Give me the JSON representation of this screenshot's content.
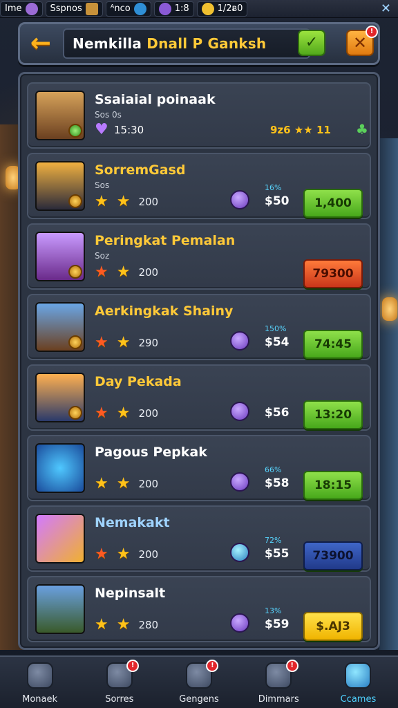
{
  "statusbar": {
    "items": [
      {
        "label": "Ime"
      },
      {
        "label": "Sspnos"
      },
      {
        "label": "ᴬnco"
      },
      {
        "label": "1:8"
      },
      {
        "label": "1/2ᴃ0"
      }
    ],
    "close": "✕"
  },
  "header": {
    "back_icon": "←",
    "title_part1": "Nemkilla ",
    "title_part2": "Dnall P Ganksh",
    "ok_icon": "✓",
    "close_icon": "✕",
    "close_badge": "!"
  },
  "rows": [
    {
      "title": "Ssaiaial poinaak",
      "title_color": "#ffffff",
      "sub": "Sos 0s",
      "time": "15:30",
      "score": "9ᴢ6 ★★ 11",
      "avatar_colors": [
        "#d6a25a",
        "#6b4020"
      ]
    },
    {
      "title": "SorremGasd",
      "title_color": "#ffc938",
      "sub": "Sos",
      "stars": "200",
      "pct": "16%",
      "price": "$50",
      "action": "1,400",
      "action_style": "green",
      "avatar_colors": [
        "#f0b040",
        "#2a2a3a"
      ]
    },
    {
      "title": "Peringkat Pemalan",
      "title_color": "#ffc938",
      "sub": "Soz",
      "stars": "200",
      "action": "79300",
      "action_style": "red",
      "avatar_colors": [
        "#c99bff",
        "#6a2a8a"
      ]
    },
    {
      "title": "Aerkingkak Shainy",
      "title_color": "#ffc938",
      "sub": "",
      "stars": "290",
      "pct": "150%",
      "price": "$54",
      "action": "74:45",
      "action_style": "green",
      "avatar_colors": [
        "#6aa6e6",
        "#6b4020"
      ]
    },
    {
      "title": "Day Pekada",
      "title_color": "#ffc938",
      "sub": "",
      "stars": "200",
      "price": "$56",
      "action": "13:20",
      "action_style": "green",
      "avatar_colors": [
        "#ffb050",
        "#2a3a6a"
      ]
    },
    {
      "title": "Pagous Pepkak",
      "title_color": "#ffffff",
      "title_accent": "#7cf05a",
      "sub": "",
      "stars": "200",
      "pct": "66%",
      "price": "$58",
      "action": "18:15",
      "action_style": "green",
      "avatar_colors": [
        "#4fc8ff",
        "#1a4a9a"
      ]
    },
    {
      "title": "Nemakakt",
      "title_color": "#9fd3ff",
      "sub": "",
      "stars": "200",
      "pct": "72%",
      "price": "$55",
      "action": "73900",
      "action_style": "blue",
      "avatar_colors": [
        "#d27aff",
        "#f0b030"
      ]
    },
    {
      "title": "Nepinsalt",
      "title_color": "#ffffff",
      "sub": "",
      "stars": "280",
      "pct": "13%",
      "price": "$59",
      "action": "$.AJ3",
      "action_style": "yellow",
      "avatar_colors": [
        "#6aa0e0",
        "#3a5a2a"
      ]
    }
  ],
  "nav": [
    {
      "label": "Monaek",
      "icon": "home-icon",
      "badge": ""
    },
    {
      "label": "Sorres",
      "icon": "shield-icon",
      "badge": "!"
    },
    {
      "label": "Gengens",
      "icon": "compass-icon",
      "badge": "!"
    },
    {
      "label": "Dimmars",
      "icon": "helmet-icon",
      "badge": "!"
    },
    {
      "label": "Ccames",
      "icon": "chest-icon",
      "badge": ""
    }
  ]
}
